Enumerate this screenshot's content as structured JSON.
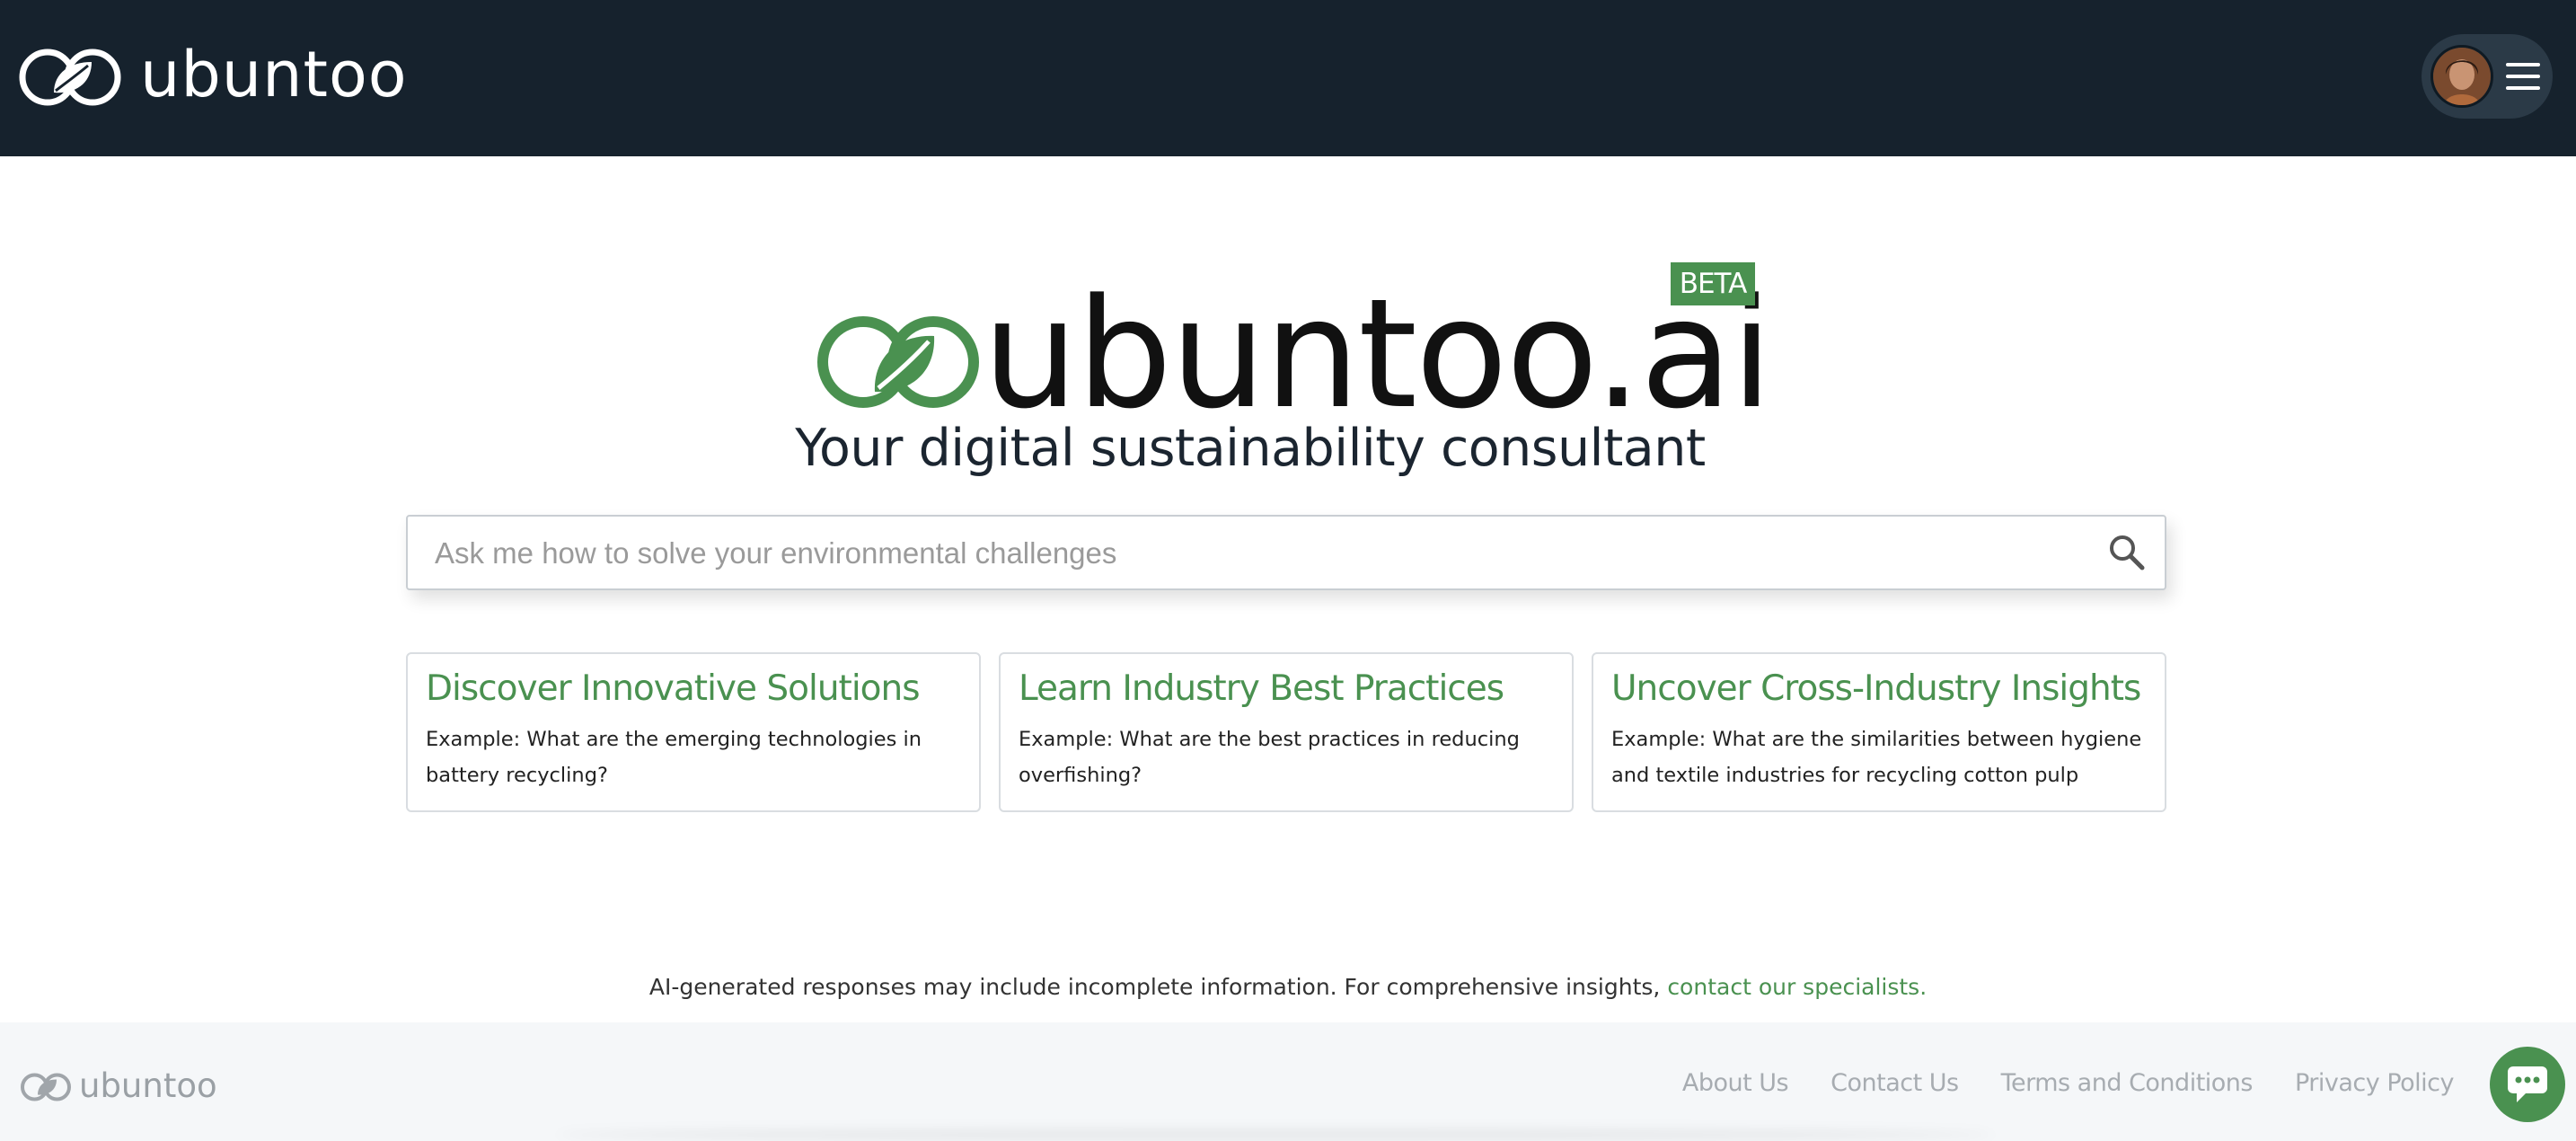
{
  "header": {
    "brand": "ubuntoo",
    "logo_icon": "ubuntoo-leaf-logo-icon",
    "menu_icon": "hamburger-menu-icon",
    "avatar_icon": "user-avatar",
    "background": "#16222d"
  },
  "hero": {
    "wordmark": "ubuntoo.ai",
    "badge": "BETA",
    "tagline": "Your digital sustainability consultant",
    "accent": "#4a9150"
  },
  "search": {
    "placeholder": "Ask me how to solve your environmental challenges",
    "value": "",
    "icon": "search-icon"
  },
  "cards": [
    {
      "title": "Discover Innovative Solutions",
      "example": "Example: What are the emerging technologies in battery recycling?"
    },
    {
      "title": "Learn Industry Best Practices",
      "example": "Example: What are the best practices in reducing overfishing?"
    },
    {
      "title": "Uncover Cross-Industry Insights",
      "example": "Example: What are the similarities between hygiene and textile industries for recycling cotton pulp"
    }
  ],
  "disclaimer": {
    "text": "AI-generated responses may include incomplete information. For comprehensive insights,",
    "link": "contact our specialists."
  },
  "footer": {
    "brand": "ubuntoo",
    "links": [
      "About Us",
      "Contact Us",
      "Terms and Conditions",
      "Privacy Policy"
    ],
    "chat_icon": "chat-bubble-icon"
  }
}
